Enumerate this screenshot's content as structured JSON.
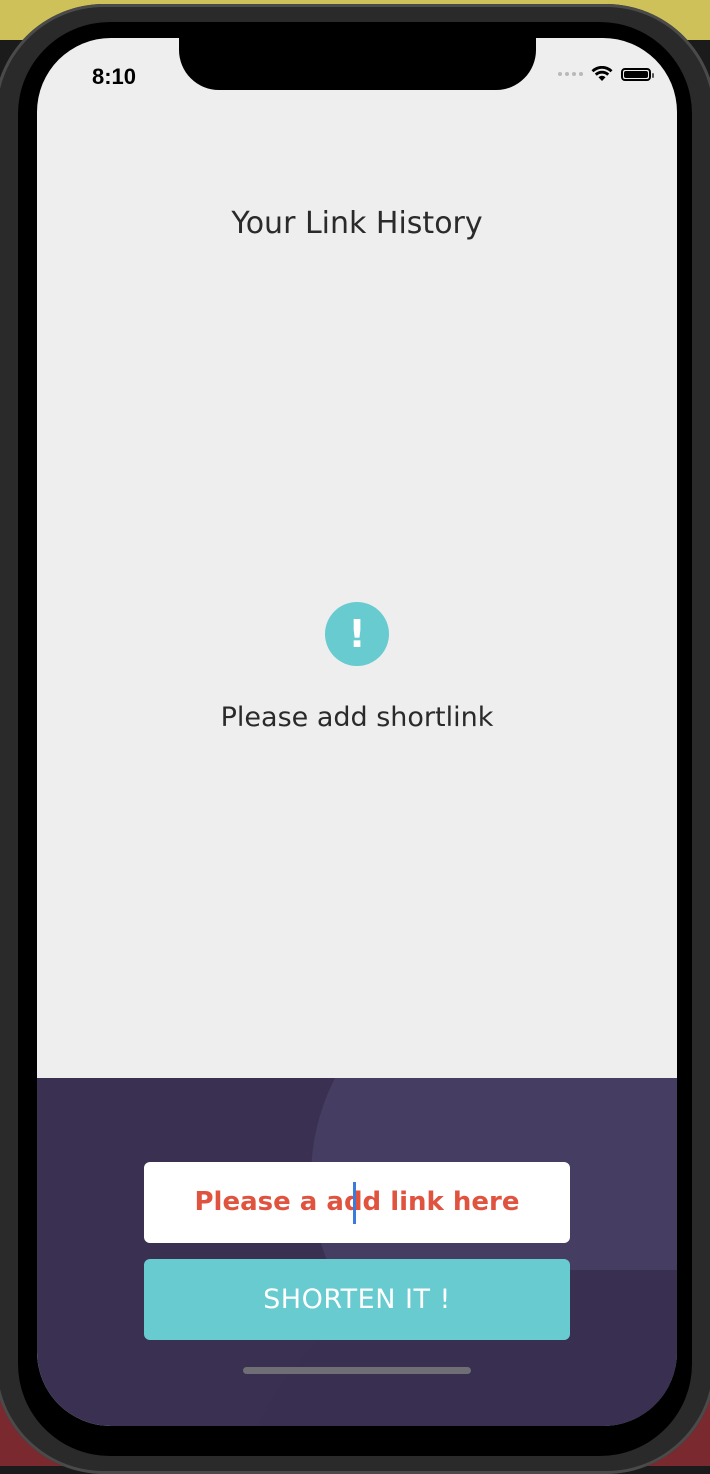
{
  "status_bar": {
    "time": "8:10",
    "icons": [
      "signal-dots-icon",
      "wifi-icon",
      "battery-icon"
    ]
  },
  "header": {
    "title": "Your Link History"
  },
  "empty_state": {
    "icon": "exclamation-circle-icon",
    "icon_glyph": "!",
    "message": "Please add shortlink"
  },
  "form": {
    "input_value": "Please a add link here",
    "button_label": "SHORTEN IT !"
  },
  "colors": {
    "accent": "#67cbd0",
    "panel": "#3a3152",
    "error_text": "#e0533f",
    "background": "#eeeeee"
  }
}
